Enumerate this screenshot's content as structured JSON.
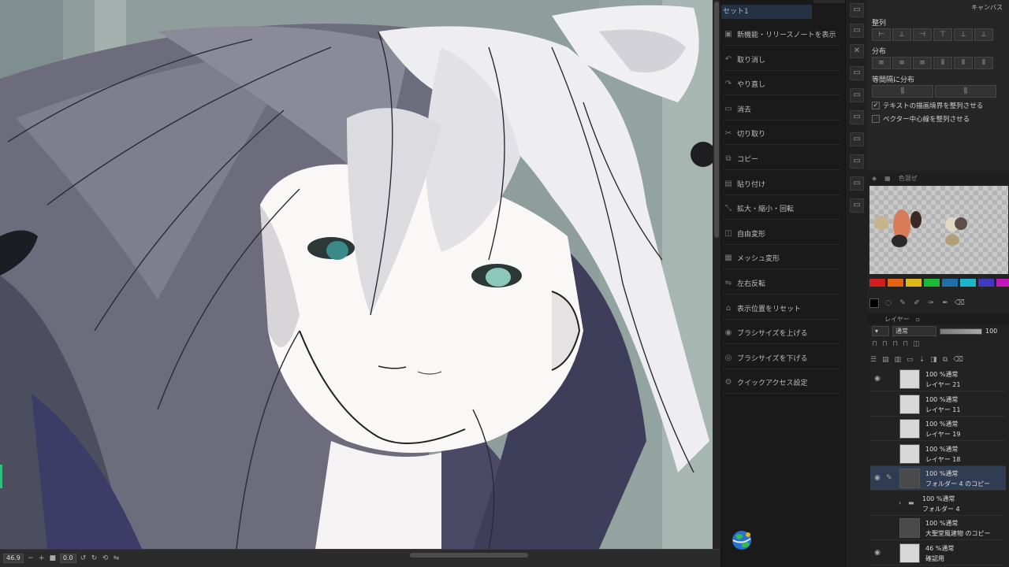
{
  "quick_access": {
    "header": "セット1",
    "items": [
      {
        "label": "新機能・リリースノートを表示",
        "icon": "release-notes-icon"
      },
      {
        "label": "取り消し",
        "icon": "undo-icon"
      },
      {
        "label": "やり直し",
        "icon": "redo-icon"
      },
      {
        "label": "消去",
        "icon": "erase-icon"
      },
      {
        "label": "切り取り",
        "icon": "cut-icon"
      },
      {
        "label": "コピー",
        "icon": "copy-icon"
      },
      {
        "label": "貼り付け",
        "icon": "paste-icon"
      },
      {
        "label": "拡大・縮小・回転",
        "icon": "scale-rotate-icon"
      },
      {
        "label": "自由変形",
        "icon": "free-transform-icon"
      },
      {
        "label": "メッシュ変形",
        "icon": "mesh-transform-icon"
      },
      {
        "label": "左右反転",
        "icon": "flip-horizontal-icon"
      },
      {
        "label": "表示位置をリセット",
        "icon": "reset-view-icon"
      },
      {
        "label": "ブラシサイズを上げる",
        "icon": "brush-size-up-icon"
      },
      {
        "label": "ブラシサイズを下げる",
        "icon": "brush-size-down-icon"
      },
      {
        "label": "クイックアクセス設定",
        "icon": "quick-access-settings-icon"
      }
    ]
  },
  "align_panel": {
    "tab": "キャンバス",
    "align_title": "整列",
    "distribute_title": "分布",
    "equal_spacing_title": "等間隔に分布",
    "checkbox_text_bounds": "テキストの描画境界を整列させる",
    "checkbox_text_bounds_checked": true,
    "checkbox_vector_center": "ベクター中心線を整列させる",
    "checkbox_vector_center_checked": false
  },
  "color_panel": {
    "tab": "色混ぜ",
    "swatches": [
      "#d11f1f",
      "#e06414",
      "#e0b719",
      "#1db838",
      "#1f6fa8",
      "#18b6c8",
      "#4338c0",
      "#c318b8"
    ],
    "blobs": [
      "#c8b48c",
      "#d87c5a",
      "#3a2a22",
      "#e0d9c4",
      "#5a5048",
      "#2a2a2a",
      "#b49e7a"
    ]
  },
  "layer_panel": {
    "tab": "レイヤー",
    "blend_mode": "通常",
    "opacity": "100",
    "layers": [
      {
        "opacity_mode": "100 %通常",
        "name": "レイヤー 21",
        "visible": true,
        "selected": false,
        "folder": false
      },
      {
        "opacity_mode": "100 %通常",
        "name": "レイヤー 11",
        "visible": false,
        "selected": false,
        "folder": false
      },
      {
        "opacity_mode": "100 %通常",
        "name": "レイヤー 19",
        "visible": false,
        "selected": false,
        "folder": false
      },
      {
        "opacity_mode": "100 %通常",
        "name": "レイヤー 18",
        "visible": false,
        "selected": false,
        "folder": false
      },
      {
        "opacity_mode": "100 %通常",
        "name": "フォルダー 4 のコピー",
        "visible": true,
        "selected": true,
        "folder": false
      },
      {
        "opacity_mode": "100 %通常",
        "name": "フォルダー 4",
        "visible": false,
        "selected": false,
        "folder": true
      },
      {
        "opacity_mode": "100 %通常",
        "name": "大聖堂風建物 のコピー",
        "visible": false,
        "selected": false,
        "folder": false
      },
      {
        "opacity_mode": "46 %通常",
        "name": "確認用",
        "visible": true,
        "selected": false,
        "folder": false
      }
    ]
  },
  "status_bar": {
    "zoom": "46.9",
    "rotation": "0.0"
  }
}
